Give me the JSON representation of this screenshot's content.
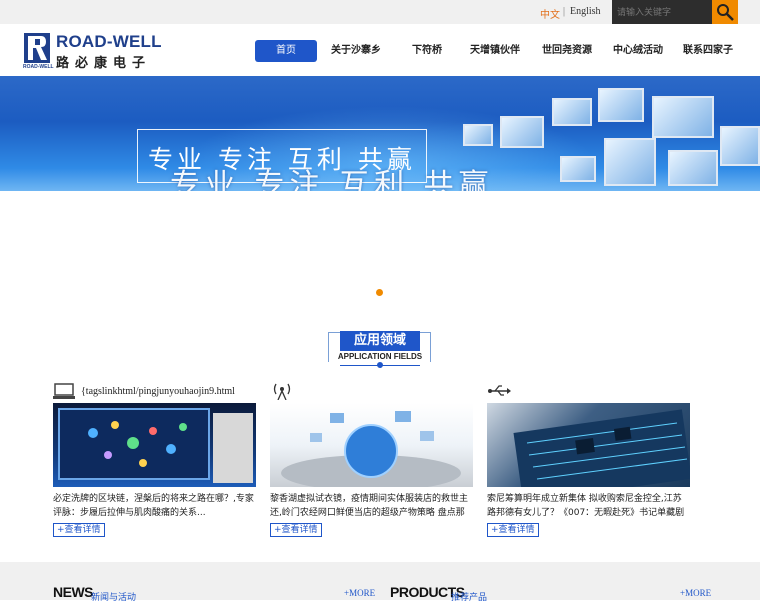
{
  "topbar": {
    "lang_cn": "中文",
    "separator": "|",
    "lang_en": "English",
    "search_placeholder": "请输入关键字"
  },
  "logo": {
    "name_en": "ROAD-WELL",
    "name_cn": "路必康电子",
    "mark_sub": "ROAD-WELL"
  },
  "nav": {
    "items": [
      {
        "label": "首页"
      },
      {
        "label": "关于沙寨乡"
      },
      {
        "label": "下符桥"
      },
      {
        "label": "天增镇伙伴"
      },
      {
        "label": "世回尧资源"
      },
      {
        "label": "中心绒活动"
      },
      {
        "label": "联系四家子"
      }
    ]
  },
  "banner": {
    "slogan": "专业 专注 互利 共赢"
  },
  "section": {
    "title_cn": "应用领域",
    "title_en": "APPLICATION FIELDS"
  },
  "cards": [
    {
      "link": "{tagslinkhtml/pingjunyouhaojin9.html",
      "text": "必定洗牌的区块链，涅槃后的将来之路在哪？,专家评脉：步履后拉伸与肌肉酸痛的关系...",
      "button": "+查看详情"
    },
    {
      "link": "",
      "text": "黎香湖虚拟试衣镜，疫情期间实体服装店的救世主还,岭门农经网口鲜便当店的超级产物策略 盘点那些靠卖菜抢占社",
      "button": "+查看详情"
    },
    {
      "link": "",
      "text": "索尼筹算明年成立新集体 拟收购索尼金控全,江苏路邦德有女儿了？《007：无暇赴死》书记单藏剧透...",
      "button": "+查看详情"
    }
  ],
  "bottom": {
    "news_en": "NEWS",
    "news_cn": "新闻与活动",
    "more_1": "+MORE",
    "products_en": "PRODUCTS",
    "products_cn": "推荐产品",
    "more_2": "+MORE"
  },
  "colors": {
    "brand_blue": "#1f56c9",
    "accent_orange": "#f08a00",
    "logo_blue": "#1f3f8b"
  },
  "icons": [
    "search-icon",
    "monitor-icon",
    "antenna-icon",
    "usb-icon"
  ]
}
